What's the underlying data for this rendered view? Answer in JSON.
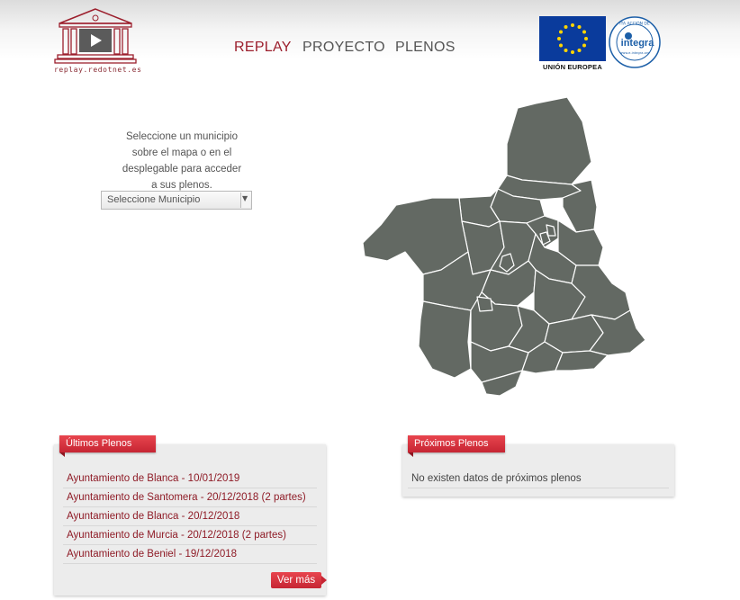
{
  "header": {
    "logo_text": "replay.redotnet.es",
    "nav": [
      {
        "label": "REPLAY",
        "active": true
      },
      {
        "label": "PROYECTO",
        "active": false
      },
      {
        "label": "PLENOS",
        "active": false
      }
    ],
    "eu_label": "UNIÓN EUROPEA",
    "seal": {
      "top_text": "ITA ACCIÓN DE",
      "brand": "integra",
      "url": "www.e-integra.org"
    }
  },
  "intro": {
    "lines": [
      "Seleccione un municipio",
      "sobre el mapa o en el",
      "desplegable para acceder",
      "a sus plenos."
    ]
  },
  "select": {
    "value": "Seleccione Municipio"
  },
  "latest": {
    "title": "Últimos Plenos",
    "items": [
      "Ayuntamiento de Blanca - 10/01/2019",
      "Ayuntamiento de Santomera - 20/12/2018 (2 partes)",
      "Ayuntamiento de Blanca - 20/12/2018",
      "Ayuntamiento de Murcia - 20/12/2018 (2 partes)",
      "Ayuntamiento de Beniel - 19/12/2018"
    ],
    "more_label": "Ver más"
  },
  "upcoming": {
    "title": "Próximos Plenos",
    "empty_text": "No existen datos de próximos plenos"
  },
  "colors": {
    "accent": "#c62533",
    "link": "#8f1c27",
    "map_fill": "#636963",
    "eu_blue": "#0a3b9c"
  },
  "icons": {
    "logo": "temple-play-icon",
    "eu": "eu-flag-icon",
    "seal": "integra-seal-icon"
  }
}
